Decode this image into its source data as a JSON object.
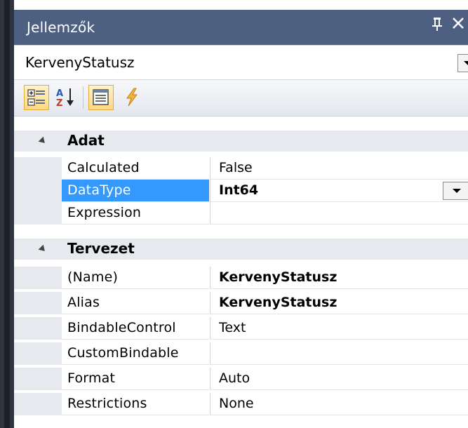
{
  "panel": {
    "title": "Jellemzők",
    "pin_icon": "pin-icon",
    "close_icon": "close-icon",
    "pin_glyph": "ا",
    "close_glyph": "✕"
  },
  "object_selector": {
    "value": "KervenyStatusz"
  },
  "toolbar": {
    "buttons": [
      {
        "name": "categorized-view",
        "icon": "categorized-icon",
        "active": true
      },
      {
        "name": "alphabetical-sort",
        "icon": "sort-az-icon",
        "active": false
      },
      {
        "name": "properties-view",
        "icon": "properties-icon",
        "active": true
      },
      {
        "name": "events-view",
        "icon": "lightning-icon",
        "active": false
      }
    ]
  },
  "grid": {
    "categories": [
      {
        "label": "Adat",
        "properties": [
          {
            "name": "Calculated",
            "value": "False",
            "bold": false
          },
          {
            "name": "DataType",
            "value": "Int64",
            "bold": true,
            "selected": true,
            "has_dropdown": true
          },
          {
            "name": "Expression",
            "value": "",
            "bold": false
          }
        ]
      },
      {
        "label": "Tervezet",
        "properties": [
          {
            "name": "(Name)",
            "value": "KervenyStatusz",
            "bold": true
          },
          {
            "name": "Alias",
            "value": "KervenyStatusz",
            "bold": true
          },
          {
            "name": "BindableControl",
            "value": "Text",
            "bold": false
          },
          {
            "name": "CustomBindable",
            "value": "",
            "bold": false
          },
          {
            "name": "Format",
            "value": "Auto",
            "bold": false
          },
          {
            "name": "Restrictions",
            "value": "None",
            "bold": false
          }
        ]
      }
    ]
  },
  "colors": {
    "title_bar": "#4d6082",
    "selection": "#3399ff",
    "category_bg": "#e6e9ee"
  }
}
